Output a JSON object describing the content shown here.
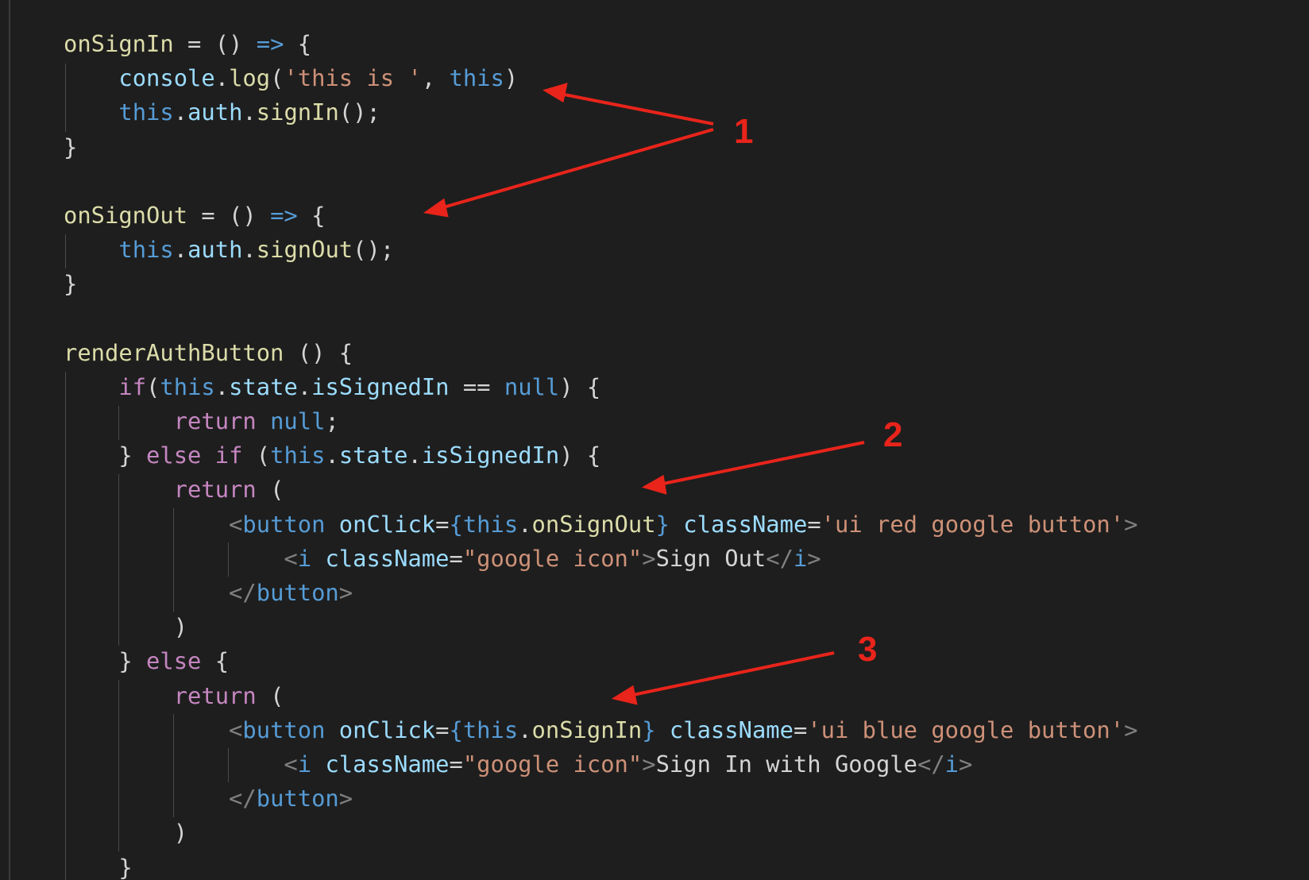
{
  "editor": {
    "lines": [
      [
        {
          "t": "onSignIn",
          "c": "fn"
        },
        {
          "t": " = () ",
          "c": "plain"
        },
        {
          "t": "=>",
          "c": "kw"
        },
        {
          "t": " {",
          "c": "plain"
        }
      ],
      [
        {
          "t": "    ",
          "c": "plain"
        },
        {
          "t": "console",
          "c": "var"
        },
        {
          "t": ".",
          "c": "plain"
        },
        {
          "t": "log",
          "c": "fn"
        },
        {
          "t": "(",
          "c": "plain"
        },
        {
          "t": "'this is '",
          "c": "str"
        },
        {
          "t": ", ",
          "c": "plain"
        },
        {
          "t": "this",
          "c": "kw"
        },
        {
          "t": ")",
          "c": "plain"
        }
      ],
      [
        {
          "t": "    ",
          "c": "plain"
        },
        {
          "t": "this",
          "c": "kw"
        },
        {
          "t": ".",
          "c": "plain"
        },
        {
          "t": "auth",
          "c": "var"
        },
        {
          "t": ".",
          "c": "plain"
        },
        {
          "t": "signIn",
          "c": "fn"
        },
        {
          "t": "();",
          "c": "plain"
        }
      ],
      [
        {
          "t": "}",
          "c": "plain"
        }
      ],
      [],
      [
        {
          "t": "onSignOut",
          "c": "fn"
        },
        {
          "t": " = () ",
          "c": "plain"
        },
        {
          "t": "=>",
          "c": "kw"
        },
        {
          "t": " {",
          "c": "plain"
        }
      ],
      [
        {
          "t": "    ",
          "c": "plain"
        },
        {
          "t": "this",
          "c": "kw"
        },
        {
          "t": ".",
          "c": "plain"
        },
        {
          "t": "auth",
          "c": "var"
        },
        {
          "t": ".",
          "c": "plain"
        },
        {
          "t": "signOut",
          "c": "fn"
        },
        {
          "t": "();",
          "c": "plain"
        }
      ],
      [
        {
          "t": "}",
          "c": "plain"
        }
      ],
      [],
      [
        {
          "t": "renderAuthButton",
          "c": "fn"
        },
        {
          "t": " () {",
          "c": "plain"
        }
      ],
      [
        {
          "t": "    ",
          "c": "plain"
        },
        {
          "t": "if",
          "c": "ctrl"
        },
        {
          "t": "(",
          "c": "plain"
        },
        {
          "t": "this",
          "c": "kw"
        },
        {
          "t": ".",
          "c": "plain"
        },
        {
          "t": "state",
          "c": "var"
        },
        {
          "t": ".",
          "c": "plain"
        },
        {
          "t": "isSignedIn",
          "c": "var"
        },
        {
          "t": " == ",
          "c": "plain"
        },
        {
          "t": "null",
          "c": "kw"
        },
        {
          "t": ") {",
          "c": "plain"
        }
      ],
      [
        {
          "t": "        ",
          "c": "plain"
        },
        {
          "t": "return",
          "c": "ctrl"
        },
        {
          "t": " ",
          "c": "plain"
        },
        {
          "t": "null",
          "c": "kw"
        },
        {
          "t": ";",
          "c": "plain"
        }
      ],
      [
        {
          "t": "    } ",
          "c": "plain"
        },
        {
          "t": "else",
          "c": "ctrl"
        },
        {
          "t": " ",
          "c": "plain"
        },
        {
          "t": "if",
          "c": "ctrl"
        },
        {
          "t": " (",
          "c": "plain"
        },
        {
          "t": "this",
          "c": "kw"
        },
        {
          "t": ".",
          "c": "plain"
        },
        {
          "t": "state",
          "c": "var"
        },
        {
          "t": ".",
          "c": "plain"
        },
        {
          "t": "isSignedIn",
          "c": "var"
        },
        {
          "t": ") {",
          "c": "plain"
        }
      ],
      [
        {
          "t": "        ",
          "c": "plain"
        },
        {
          "t": "return",
          "c": "ctrl"
        },
        {
          "t": " (",
          "c": "plain"
        }
      ],
      [
        {
          "t": "            ",
          "c": "plain"
        },
        {
          "t": "<",
          "c": "brk"
        },
        {
          "t": "button",
          "c": "tag"
        },
        {
          "t": " ",
          "c": "plain"
        },
        {
          "t": "onClick",
          "c": "attr"
        },
        {
          "t": "=",
          "c": "plain"
        },
        {
          "t": "{",
          "c": "kw"
        },
        {
          "t": "this",
          "c": "kw"
        },
        {
          "t": ".",
          "c": "plain"
        },
        {
          "t": "onSignOut",
          "c": "fn"
        },
        {
          "t": "}",
          "c": "kw"
        },
        {
          "t": " ",
          "c": "plain"
        },
        {
          "t": "className",
          "c": "attr"
        },
        {
          "t": "=",
          "c": "plain"
        },
        {
          "t": "'ui red google button'",
          "c": "str"
        },
        {
          "t": ">",
          "c": "brk"
        }
      ],
      [
        {
          "t": "                ",
          "c": "plain"
        },
        {
          "t": "<",
          "c": "brk"
        },
        {
          "t": "i",
          "c": "tag"
        },
        {
          "t": " ",
          "c": "plain"
        },
        {
          "t": "className",
          "c": "attr"
        },
        {
          "t": "=",
          "c": "plain"
        },
        {
          "t": "\"google icon\"",
          "c": "str"
        },
        {
          "t": ">",
          "c": "brk"
        },
        {
          "t": "Sign Out",
          "c": "text"
        },
        {
          "t": "</",
          "c": "brk"
        },
        {
          "t": "i",
          "c": "tag"
        },
        {
          "t": ">",
          "c": "brk"
        }
      ],
      [
        {
          "t": "            ",
          "c": "plain"
        },
        {
          "t": "</",
          "c": "brk"
        },
        {
          "t": "button",
          "c": "tag"
        },
        {
          "t": ">",
          "c": "brk"
        }
      ],
      [
        {
          "t": "        )",
          "c": "plain"
        }
      ],
      [
        {
          "t": "    } ",
          "c": "plain"
        },
        {
          "t": "else",
          "c": "ctrl"
        },
        {
          "t": " {",
          "c": "plain"
        }
      ],
      [
        {
          "t": "        ",
          "c": "plain"
        },
        {
          "t": "return",
          "c": "ctrl"
        },
        {
          "t": " (",
          "c": "plain"
        }
      ],
      [
        {
          "t": "            ",
          "c": "plain"
        },
        {
          "t": "<",
          "c": "brk"
        },
        {
          "t": "button",
          "c": "tag"
        },
        {
          "t": " ",
          "c": "plain"
        },
        {
          "t": "onClick",
          "c": "attr"
        },
        {
          "t": "=",
          "c": "plain"
        },
        {
          "t": "{",
          "c": "kw"
        },
        {
          "t": "this",
          "c": "kw"
        },
        {
          "t": ".",
          "c": "plain"
        },
        {
          "t": "onSignIn",
          "c": "fn"
        },
        {
          "t": "}",
          "c": "kw"
        },
        {
          "t": " ",
          "c": "plain"
        },
        {
          "t": "className",
          "c": "attr"
        },
        {
          "t": "=",
          "c": "plain"
        },
        {
          "t": "'ui blue google button'",
          "c": "str"
        },
        {
          "t": ">",
          "c": "brk"
        }
      ],
      [
        {
          "t": "                ",
          "c": "plain"
        },
        {
          "t": "<",
          "c": "brk"
        },
        {
          "t": "i",
          "c": "tag"
        },
        {
          "t": " ",
          "c": "plain"
        },
        {
          "t": "className",
          "c": "attr"
        },
        {
          "t": "=",
          "c": "plain"
        },
        {
          "t": "\"google icon\"",
          "c": "str"
        },
        {
          "t": ">",
          "c": "brk"
        },
        {
          "t": "Sign In with Google",
          "c": "text"
        },
        {
          "t": "</",
          "c": "brk"
        },
        {
          "t": "i",
          "c": "tag"
        },
        {
          "t": ">",
          "c": "brk"
        }
      ],
      [
        {
          "t": "            ",
          "c": "plain"
        },
        {
          "t": "</",
          "c": "brk"
        },
        {
          "t": "button",
          "c": "tag"
        },
        {
          "t": ">",
          "c": "brk"
        }
      ],
      [
        {
          "t": "        )",
          "c": "plain"
        }
      ],
      [
        {
          "t": "    }",
          "c": "plain"
        }
      ]
    ]
  },
  "annotations": {
    "labels": [
      "1",
      "2",
      "3"
    ],
    "color": "#e8241b"
  },
  "theme": {
    "background": "#1e1e1e",
    "function": "#dcdcaa",
    "keyword": "#569cd6",
    "control": "#c586c0",
    "variable": "#9cdcfe",
    "string": "#ce9178",
    "punctuation": "#808080",
    "text": "#d4d4d4"
  }
}
